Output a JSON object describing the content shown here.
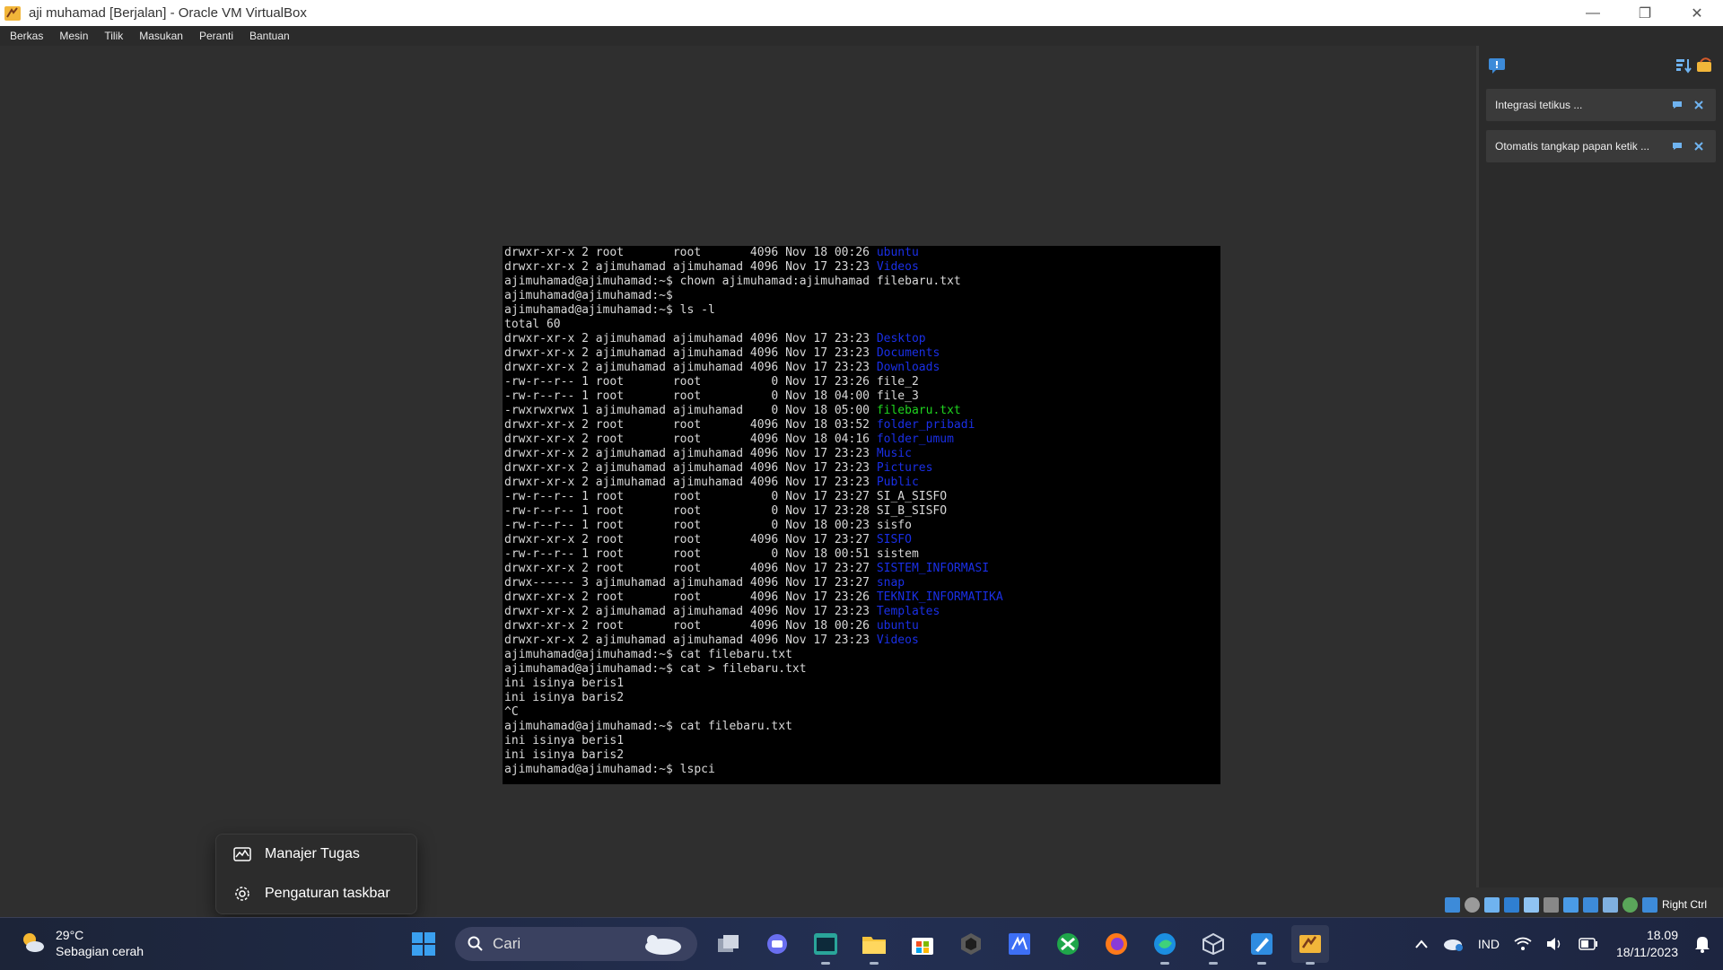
{
  "window": {
    "title": "aji muhamad  [Berjalan] - Oracle VM VirtualBox",
    "minimize": "—",
    "restore": "❐",
    "close": "✕"
  },
  "menu": [
    "Berkas",
    "Mesin",
    "Tilik",
    "Masukan",
    "Peranti",
    "Bantuan"
  ],
  "terminal": {
    "lines": [
      [
        {
          "t": "drwxr-xr-x 2 root       root       4096 Nov 18 00:26 "
        },
        {
          "t": "ubuntu",
          "c": "blue"
        }
      ],
      [
        {
          "t": "drwxr-xr-x 2 ajimuhamad ajimuhamad 4096 Nov 17 23:23 "
        },
        {
          "t": "Videos",
          "c": "blue"
        }
      ],
      [
        {
          "t": "ajimuhamad@ajimuhamad:~$ chown ajimuhamad:ajimuhamad filebaru.txt"
        }
      ],
      [
        {
          "t": "ajimuhamad@ajimuhamad:~$"
        }
      ],
      [
        {
          "t": "ajimuhamad@ajimuhamad:~$ ls -l"
        }
      ],
      [
        {
          "t": "total 60"
        }
      ],
      [
        {
          "t": "drwxr-xr-x 2 ajimuhamad ajimuhamad 4096 Nov 17 23:23 "
        },
        {
          "t": "Desktop",
          "c": "blue"
        }
      ],
      [
        {
          "t": "drwxr-xr-x 2 ajimuhamad ajimuhamad 4096 Nov 17 23:23 "
        },
        {
          "t": "Documents",
          "c": "blue"
        }
      ],
      [
        {
          "t": "drwxr-xr-x 2 ajimuhamad ajimuhamad 4096 Nov 17 23:23 "
        },
        {
          "t": "Downloads",
          "c": "blue"
        }
      ],
      [
        {
          "t": "-rw-r--r-- 1 root       root          0 Nov 17 23:26 file_2"
        }
      ],
      [
        {
          "t": "-rw-r--r-- 1 root       root          0 Nov 18 04:00 file_3"
        }
      ],
      [
        {
          "t": "-rwxrwxrwx 1 ajimuhamad ajimuhamad    0 Nov 18 05:00 "
        },
        {
          "t": "filebaru.txt",
          "c": "green"
        }
      ],
      [
        {
          "t": "drwxr-xr-x 2 root       root       4096 Nov 18 03:52 "
        },
        {
          "t": "folder_pribadi",
          "c": "blue"
        }
      ],
      [
        {
          "t": "drwxr-xr-x 2 root       root       4096 Nov 18 04:16 "
        },
        {
          "t": "folder_umum",
          "c": "blue"
        }
      ],
      [
        {
          "t": "drwxr-xr-x 2 ajimuhamad ajimuhamad 4096 Nov 17 23:23 "
        },
        {
          "t": "Music",
          "c": "blue"
        }
      ],
      [
        {
          "t": "drwxr-xr-x 2 ajimuhamad ajimuhamad 4096 Nov 17 23:23 "
        },
        {
          "t": "Pictures",
          "c": "blue"
        }
      ],
      [
        {
          "t": "drwxr-xr-x 2 ajimuhamad ajimuhamad 4096 Nov 17 23:23 "
        },
        {
          "t": "Public",
          "c": "blue"
        }
      ],
      [
        {
          "t": "-rw-r--r-- 1 root       root          0 Nov 17 23:27 SI_A_SISFO"
        }
      ],
      [
        {
          "t": "-rw-r--r-- 1 root       root          0 Nov 17 23:28 SI_B_SISFO"
        }
      ],
      [
        {
          "t": "-rw-r--r-- 1 root       root          0 Nov 18 00:23 sisfo"
        }
      ],
      [
        {
          "t": "drwxr-xr-x 2 root       root       4096 Nov 17 23:27 "
        },
        {
          "t": "SISFO",
          "c": "blue"
        }
      ],
      [
        {
          "t": "-rw-r--r-- 1 root       root          0 Nov 18 00:51 sistem"
        }
      ],
      [
        {
          "t": "drwxr-xr-x 2 root       root       4096 Nov 17 23:27 "
        },
        {
          "t": "SISTEM_INFORMASI",
          "c": "blue"
        }
      ],
      [
        {
          "t": "drwx------ 3 ajimuhamad ajimuhamad 4096 Nov 17 23:27 "
        },
        {
          "t": "snap",
          "c": "blue"
        }
      ],
      [
        {
          "t": "drwxr-xr-x 2 root       root       4096 Nov 17 23:26 "
        },
        {
          "t": "TEKNIK_INFORMATIKA",
          "c": "blue"
        }
      ],
      [
        {
          "t": "drwxr-xr-x 2 ajimuhamad ajimuhamad 4096 Nov 17 23:23 "
        },
        {
          "t": "Templates",
          "c": "blue"
        }
      ],
      [
        {
          "t": "drwxr-xr-x 2 root       root       4096 Nov 18 00:26 "
        },
        {
          "t": "ubuntu",
          "c": "blue"
        }
      ],
      [
        {
          "t": "drwxr-xr-x 2 ajimuhamad ajimuhamad 4096 Nov 17 23:23 "
        },
        {
          "t": "Videos",
          "c": "blue"
        }
      ],
      [
        {
          "t": "ajimuhamad@ajimuhamad:~$ cat filebaru.txt"
        }
      ],
      [
        {
          "t": "ajimuhamad@ajimuhamad:~$ cat > filebaru.txt"
        }
      ],
      [
        {
          "t": "ini isinya beris1"
        }
      ],
      [
        {
          "t": "ini isinya baris2"
        }
      ],
      [
        {
          "t": "^C"
        }
      ],
      [
        {
          "t": "ajimuhamad@ajimuhamad:~$ cat filebaru.txt"
        }
      ],
      [
        {
          "t": "ini isinya beris1"
        }
      ],
      [
        {
          "t": "ini isinya baris2"
        }
      ],
      [
        {
          "t": "ajimuhamad@ajimuhamad:~$ lspci"
        }
      ]
    ],
    "colors": {
      "blue": "#1a2fe6",
      "green": "#1fd41f"
    }
  },
  "sidepanel": {
    "notifications": [
      {
        "text": "Integrasi tetikus ..."
      },
      {
        "text": "Otomatis tangkap papan ketik ..."
      }
    ]
  },
  "vbox_status": {
    "host_key": "Right Ctrl"
  },
  "context_menu": {
    "items": [
      {
        "label": "Manajer Tugas",
        "icon": "task-manager-icon"
      },
      {
        "label": "Pengaturan taskbar",
        "icon": "gear-icon"
      }
    ]
  },
  "taskbar": {
    "weather": {
      "temp": "29°C",
      "desc": "Sebagian cerah"
    },
    "search_placeholder": "Cari",
    "tray": {
      "language": "IND",
      "time": "18.09",
      "date": "18/11/2023"
    }
  }
}
